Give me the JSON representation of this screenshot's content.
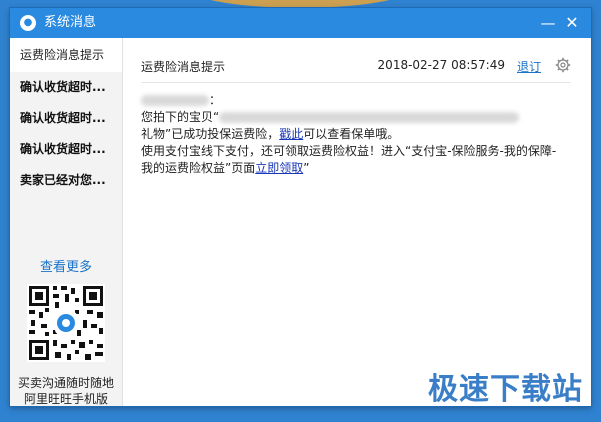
{
  "window": {
    "title": "系统消息",
    "icon": "wangwang-icon"
  },
  "sidebar": {
    "items": [
      {
        "label": "运费险消息提示"
      },
      {
        "label": "确认收货超时..."
      },
      {
        "label": "确认收货超时..."
      },
      {
        "label": "确认收货超时..."
      },
      {
        "label": "卖家已经对您..."
      }
    ],
    "more": "查看更多",
    "qr_caption_1": "买卖沟通随时随地",
    "qr_caption_2": "阿里旺旺手机版"
  },
  "message": {
    "title": "运费险消息提示",
    "time": "2018-02-27 08:57:49",
    "unsubscribe": "退订",
    "line1_suffix": "：",
    "line2_prefix": "您拍下的宝贝“",
    "line3_a": "礼物”已成功投保运费险，",
    "line3_link": "戳此",
    "line3_b": "可以查看保单哦。",
    "line4": "使用支付宝线下支付，还可领取运费险权益！进入“支付宝-保险服务-我的保障-",
    "line5_a": "我的运费险权益”页面",
    "line5_link": "立即领取",
    "line5_b": "”"
  },
  "watermark": "极速下载站"
}
